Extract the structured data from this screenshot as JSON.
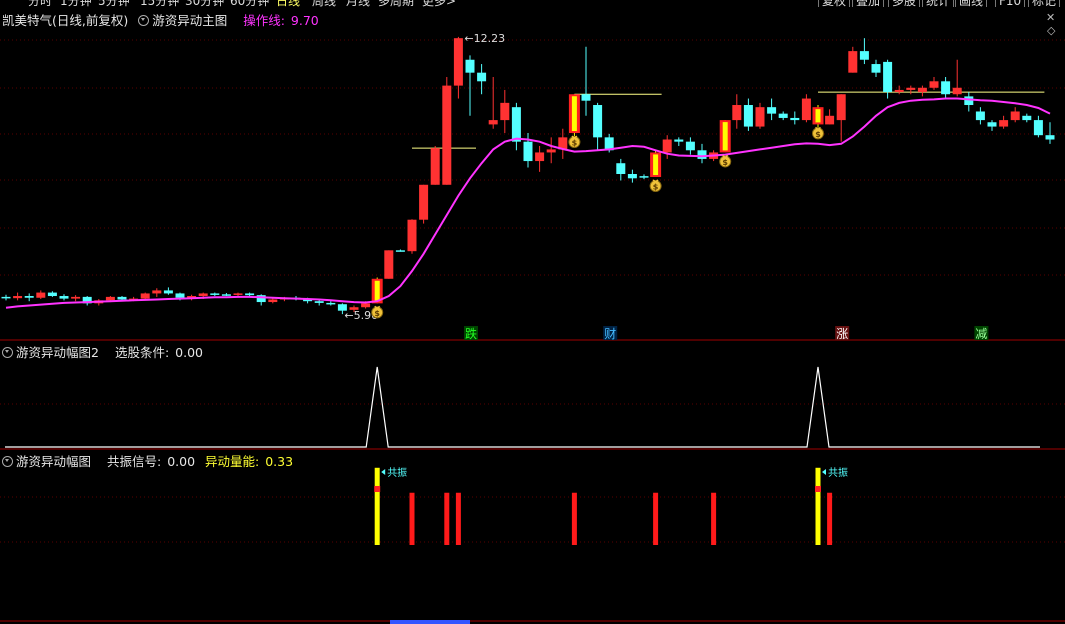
{
  "topbar": {
    "periods": [
      "分时",
      "1分钟",
      "5分钟",
      "15分钟",
      "30分钟",
      "60分钟",
      "日线",
      "周线",
      "月线",
      "多周期",
      "更多>"
    ],
    "active": "日线",
    "buttons": [
      "复权",
      "叠加",
      "多股",
      "统计",
      "画线",
      "F10",
      "标记"
    ]
  },
  "main_header": {
    "stock_name": "凯美特气(日线,前复权)",
    "indicator": "游资异动主图",
    "line_label": "操作线:",
    "line_value": "9.70"
  },
  "pane2_header": {
    "indicator": "游资异动幅图2",
    "label": "选股条件:",
    "value": "0.00"
  },
  "pane3_header": {
    "indicator": "游资异动幅图",
    "label1": "共振信号:",
    "value1": "0.00",
    "label2": "异动量能:",
    "value2": "0.33"
  },
  "colors": {
    "up": "#ff3232",
    "down": "#54ffff",
    "ma": "#ff33ff",
    "signal": "#ffff00",
    "grid": "#5a0000",
    "axis": "#a00000",
    "bg": "#000000"
  },
  "chart_data": [
    {
      "type": "candlestick",
      "pane": "main",
      "ylim": [
        5.2,
        12.9
      ],
      "high_label": "12.23",
      "low_label": "5.90",
      "ohlc": [
        [
          6.2,
          6.25,
          6.12,
          6.17
        ],
        [
          6.17,
          6.3,
          6.12,
          6.22
        ],
        [
          6.22,
          6.28,
          6.1,
          6.18
        ],
        [
          6.18,
          6.35,
          6.15,
          6.3
        ],
        [
          6.3,
          6.33,
          6.2,
          6.22
        ],
        [
          6.22,
          6.26,
          6.12,
          6.16
        ],
        [
          6.16,
          6.24,
          6.1,
          6.2
        ],
        [
          6.2,
          6.22,
          6.0,
          6.05
        ],
        [
          6.05,
          6.15,
          6.0,
          6.12
        ],
        [
          6.12,
          6.22,
          6.08,
          6.2
        ],
        [
          6.2,
          6.22,
          6.1,
          6.14
        ],
        [
          6.14,
          6.2,
          6.1,
          6.16
        ],
        [
          6.16,
          6.3,
          6.12,
          6.28
        ],
        [
          6.28,
          6.4,
          6.2,
          6.35
        ],
        [
          6.35,
          6.42,
          6.25,
          6.28
        ],
        [
          6.28,
          6.3,
          6.12,
          6.18
        ],
        [
          6.18,
          6.25,
          6.12,
          6.22
        ],
        [
          6.22,
          6.3,
          6.15,
          6.28
        ],
        [
          6.28,
          6.3,
          6.22,
          6.26
        ],
        [
          6.26,
          6.29,
          6.22,
          6.25
        ],
        [
          6.25,
          6.3,
          6.2,
          6.28
        ],
        [
          6.28,
          6.3,
          6.22,
          6.24
        ],
        [
          6.24,
          6.26,
          6.0,
          6.08
        ],
        [
          6.08,
          6.18,
          6.05,
          6.14
        ],
        [
          6.14,
          6.2,
          6.1,
          6.18
        ],
        [
          6.18,
          6.22,
          6.12,
          6.16
        ],
        [
          6.16,
          6.18,
          6.05,
          6.1
        ],
        [
          6.1,
          6.14,
          6.0,
          6.06
        ],
        [
          6.06,
          6.1,
          6.0,
          6.03
        ],
        [
          6.03,
          6.05,
          5.8,
          5.88
        ],
        [
          5.9,
          6.0,
          5.85,
          5.96
        ],
        [
          5.96,
          6.1,
          5.93,
          6.05
        ],
        [
          6.05,
          6.65,
          6.05,
          6.62
        ],
        [
          6.62,
          7.28,
          6.62,
          7.28
        ],
        [
          7.28,
          7.3,
          7.25,
          7.26
        ],
        [
          7.26,
          8.0,
          7.2,
          7.99
        ],
        [
          7.99,
          8.8,
          7.9,
          8.8
        ],
        [
          8.8,
          9.7,
          8.8,
          9.65
        ],
        [
          8.8,
          11.3,
          8.8,
          11.1
        ],
        [
          11.1,
          12.23,
          10.8,
          12.2
        ],
        [
          11.7,
          11.8,
          10.4,
          11.4
        ],
        [
          11.4,
          11.6,
          10.9,
          11.2
        ],
        [
          10.2,
          11.3,
          10.1,
          10.3
        ],
        [
          10.3,
          11.0,
          10.0,
          10.7
        ],
        [
          10.6,
          10.7,
          9.6,
          9.8
        ],
        [
          9.8,
          10.0,
          9.2,
          9.35
        ],
        [
          9.35,
          9.7,
          9.1,
          9.55
        ],
        [
          9.55,
          9.9,
          9.3,
          9.62
        ],
        [
          9.62,
          10.1,
          9.4,
          9.9
        ],
        [
          10.0,
          10.9,
          9.75,
          10.9
        ],
        [
          10.9,
          12.0,
          10.4,
          10.75
        ],
        [
          10.65,
          10.7,
          9.6,
          9.9
        ],
        [
          9.9,
          9.98,
          9.55,
          9.6
        ],
        [
          9.3,
          9.4,
          8.9,
          9.05
        ],
        [
          9.05,
          9.15,
          8.85,
          8.95
        ],
        [
          9.0,
          9.04,
          8.93,
          8.98
        ],
        [
          8.98,
          9.6,
          8.98,
          9.55
        ],
        [
          9.55,
          9.95,
          9.4,
          9.85
        ],
        [
          9.85,
          9.9,
          9.7,
          9.8
        ],
        [
          9.8,
          9.9,
          9.5,
          9.6
        ],
        [
          9.6,
          9.75,
          9.3,
          9.4
        ],
        [
          9.4,
          9.6,
          9.35,
          9.55
        ],
        [
          9.55,
          10.3,
          9.55,
          10.3
        ],
        [
          10.3,
          10.9,
          10.1,
          10.65
        ],
        [
          10.65,
          10.8,
          10.05,
          10.15
        ],
        [
          10.15,
          10.7,
          10.1,
          10.6
        ],
        [
          10.6,
          10.8,
          10.3,
          10.45
        ],
        [
          10.45,
          10.5,
          10.3,
          10.35
        ],
        [
          10.35,
          10.5,
          10.2,
          10.3
        ],
        [
          10.3,
          10.9,
          10.25,
          10.8
        ],
        [
          10.6,
          10.65,
          10.05,
          10.2
        ],
        [
          10.2,
          10.55,
          10.2,
          10.4
        ],
        [
          10.3,
          10.9,
          9.8,
          10.9
        ],
        [
          11.4,
          12.0,
          11.4,
          11.9
        ],
        [
          11.9,
          12.2,
          11.6,
          11.7
        ],
        [
          11.6,
          11.7,
          11.3,
          11.4
        ],
        [
          11.65,
          11.7,
          10.8,
          10.95
        ],
        [
          10.95,
          11.1,
          10.9,
          11.0
        ],
        [
          11.0,
          11.1,
          10.9,
          11.05
        ],
        [
          10.95,
          11.1,
          10.85,
          11.05
        ],
        [
          11.05,
          11.3,
          11.0,
          11.2
        ],
        [
          11.2,
          11.3,
          10.8,
          10.9
        ],
        [
          10.9,
          11.7,
          10.85,
          11.05
        ],
        [
          10.85,
          10.95,
          10.5,
          10.65
        ],
        [
          10.5,
          10.6,
          10.2,
          10.3
        ],
        [
          10.25,
          10.3,
          10.05,
          10.15
        ],
        [
          10.15,
          10.4,
          10.1,
          10.3
        ],
        [
          10.3,
          10.6,
          10.25,
          10.5
        ],
        [
          10.4,
          10.45,
          10.25,
          10.3
        ],
        [
          10.3,
          10.4,
          9.9,
          9.95
        ],
        [
          9.95,
          10.25,
          9.75,
          9.85
        ]
      ],
      "ma_line": [
        5.95,
        5.98,
        6.0,
        6.02,
        6.04,
        6.06,
        6.07,
        6.08,
        6.09,
        6.1,
        6.11,
        6.12,
        6.13,
        6.14,
        6.15,
        6.16,
        6.17,
        6.18,
        6.19,
        6.19,
        6.2,
        6.2,
        6.19,
        6.18,
        6.17,
        6.16,
        6.15,
        6.14,
        6.12,
        6.1,
        6.08,
        6.07,
        6.1,
        6.22,
        6.45,
        6.8,
        7.2,
        7.65,
        8.1,
        8.55,
        8.95,
        9.3,
        9.62,
        9.8,
        9.87,
        9.85,
        9.8,
        9.7,
        9.63,
        9.57,
        9.58,
        9.6,
        9.62,
        9.66,
        9.7,
        9.68,
        9.6,
        9.52,
        9.48,
        9.47,
        9.46,
        9.48,
        9.5,
        9.54,
        9.58,
        9.62,
        9.66,
        9.7,
        9.74,
        9.76,
        9.75,
        9.72,
        9.75,
        9.92,
        10.15,
        10.4,
        10.6,
        10.7,
        10.75,
        10.77,
        10.78,
        10.8,
        10.8,
        10.78,
        10.76,
        10.75,
        10.72,
        10.69,
        10.65,
        10.58,
        10.45
      ],
      "signal_bars": [
        32,
        49,
        56,
        62,
        70
      ],
      "extra_up_bars": [
        72
      ],
      "money_markers": [
        32,
        49,
        56,
        62,
        70
      ],
      "markers": [
        {
          "index": 40,
          "text": "跌",
          "color": "#22ff22",
          "bg": "#004400"
        },
        {
          "index": 52,
          "text": "财",
          "color": "#44bbff",
          "bg": "#002244"
        },
        {
          "index": 72,
          "text": "涨",
          "color": "#ffffff",
          "bg": "#661111"
        },
        {
          "index": 84,
          "text": "减",
          "color": "#99ff99",
          "bg": "#004400"
        }
      ],
      "ref_lines": [
        {
          "from": 35,
          "to": 40,
          "value": 9.65
        },
        {
          "from": 49,
          "to": 56,
          "value": 10.9
        },
        {
          "from": 70,
          "to": 89,
          "value": 10.95
        }
      ]
    },
    {
      "type": "line",
      "pane": "pane2",
      "ylim": [
        0,
        1.15
      ],
      "values_peaks": [
        {
          "index": 32,
          "value": 1
        },
        {
          "index": 70,
          "value": 1
        }
      ]
    },
    {
      "type": "bar",
      "pane": "pane3",
      "ylim": [
        0,
        1.0
      ],
      "bars": [
        {
          "index": 32,
          "value": 0.99,
          "color": "#ffff00"
        },
        {
          "index": 35,
          "value": 0.67,
          "color": "#ff1a1a"
        },
        {
          "index": 38,
          "value": 0.67,
          "color": "#ff1a1a"
        },
        {
          "index": 39,
          "value": 0.67,
          "color": "#ff1a1a"
        },
        {
          "index": 49,
          "value": 0.67,
          "color": "#ff1a1a"
        },
        {
          "index": 56,
          "value": 0.67,
          "color": "#ff1a1a"
        },
        {
          "index": 61,
          "value": 0.67,
          "color": "#ff1a1a"
        },
        {
          "index": 70,
          "value": 0.99,
          "color": "#ffff00"
        },
        {
          "index": 71,
          "value": 0.67,
          "color": "#ff1a1a"
        }
      ],
      "resonance_label": "共振",
      "resonance_indices": [
        32,
        70
      ]
    }
  ]
}
